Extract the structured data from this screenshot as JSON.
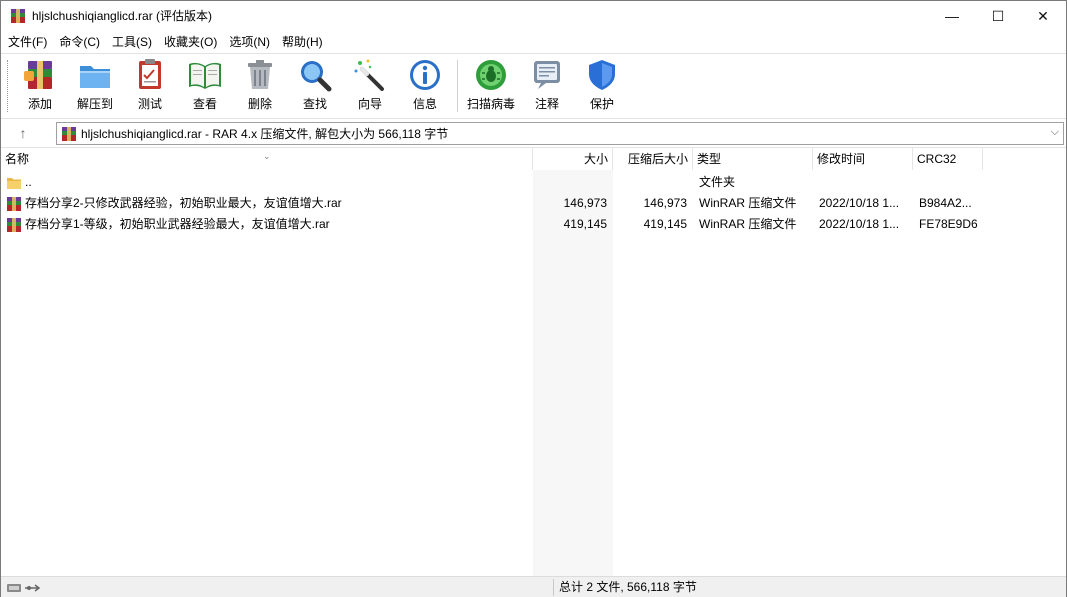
{
  "window": {
    "title": "hljslchushiqianglicd.rar (评估版本)",
    "controls": {
      "minimize": "—",
      "maximize": "☐",
      "close": "✕"
    }
  },
  "menu": [
    "文件(F)",
    "命令(C)",
    "工具(S)",
    "收藏夹(O)",
    "选项(N)",
    "帮助(H)"
  ],
  "toolbar": [
    {
      "label": "添加",
      "icon": "add-archive-icon"
    },
    {
      "label": "解压到",
      "icon": "extract-to-icon"
    },
    {
      "label": "测试",
      "icon": "test-icon"
    },
    {
      "label": "查看",
      "icon": "view-book-icon"
    },
    {
      "label": "删除",
      "icon": "delete-trash-icon"
    },
    {
      "label": "查找",
      "icon": "find-magnifier-icon"
    },
    {
      "label": "向导",
      "icon": "wizard-wand-icon"
    },
    {
      "label": "信息",
      "icon": "info-icon"
    },
    {
      "label": "扫描病毒",
      "icon": "scan-virus-icon"
    },
    {
      "label": "注释",
      "icon": "comment-icon"
    },
    {
      "label": "保护",
      "icon": "protect-shield-icon"
    }
  ],
  "address": {
    "up": "↑",
    "path": "hljslchushiqianglicd.rar - RAR 4.x 压缩文件, 解包大小为 566,118 字节",
    "dropdown": "⌵"
  },
  "columns": {
    "name": "名称",
    "size": "大小",
    "packed": "压缩后大小",
    "type": "类型",
    "modified": "修改时间",
    "crc": "CRC32"
  },
  "rows": [
    {
      "name": "..",
      "size": "",
      "packed": "",
      "type": "文件夹",
      "modified": "",
      "crc": ""
    },
    {
      "name": "存档分享2-只修改武器经验，初始职业最大，友谊值增大.rar",
      "size": "146,973",
      "packed": "146,973",
      "type": "WinRAR 压缩文件",
      "modified": "2022/10/18 1...",
      "crc": "B984A2..."
    },
    {
      "name": "存档分享1-等级，初始职业武器经验最大，友谊值增大.rar",
      "size": "419,145",
      "packed": "419,145",
      "type": "WinRAR 压缩文件",
      "modified": "2022/10/18 1...",
      "crc": "FE78E9D6"
    }
  ],
  "status": {
    "text": "总计 2 文件, 566,118 字节"
  },
  "colors": {
    "accent_blue": "#1f6fd0",
    "rar_red": "#b3262c",
    "rar_green": "#2e8b3a",
    "rar_purple": "#6a3a9a"
  }
}
